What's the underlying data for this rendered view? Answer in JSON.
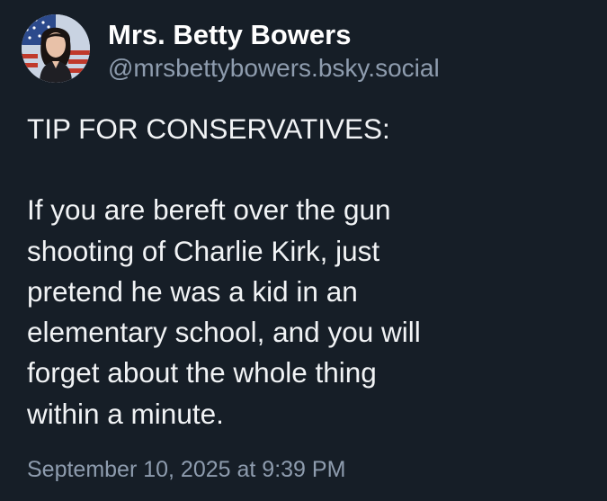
{
  "post": {
    "author": {
      "display_name": "Mrs. Betty Bowers",
      "handle": "@mrsbettybowers.bsky.social"
    },
    "body": {
      "heading": "TIP FOR CONSERVATIVES:",
      "paragraph": "If you are bereft over the gun\nshooting of Charlie Kirk, just\npretend he was a kid in an\nelementary school, and you will\nforget about the whole thing\nwithin a minute."
    },
    "timestamp": "September 10, 2025 at 9:39 PM"
  },
  "colors": {
    "background": "#161e27",
    "text": "#f1f3f5",
    "muted": "#8e9cae"
  }
}
